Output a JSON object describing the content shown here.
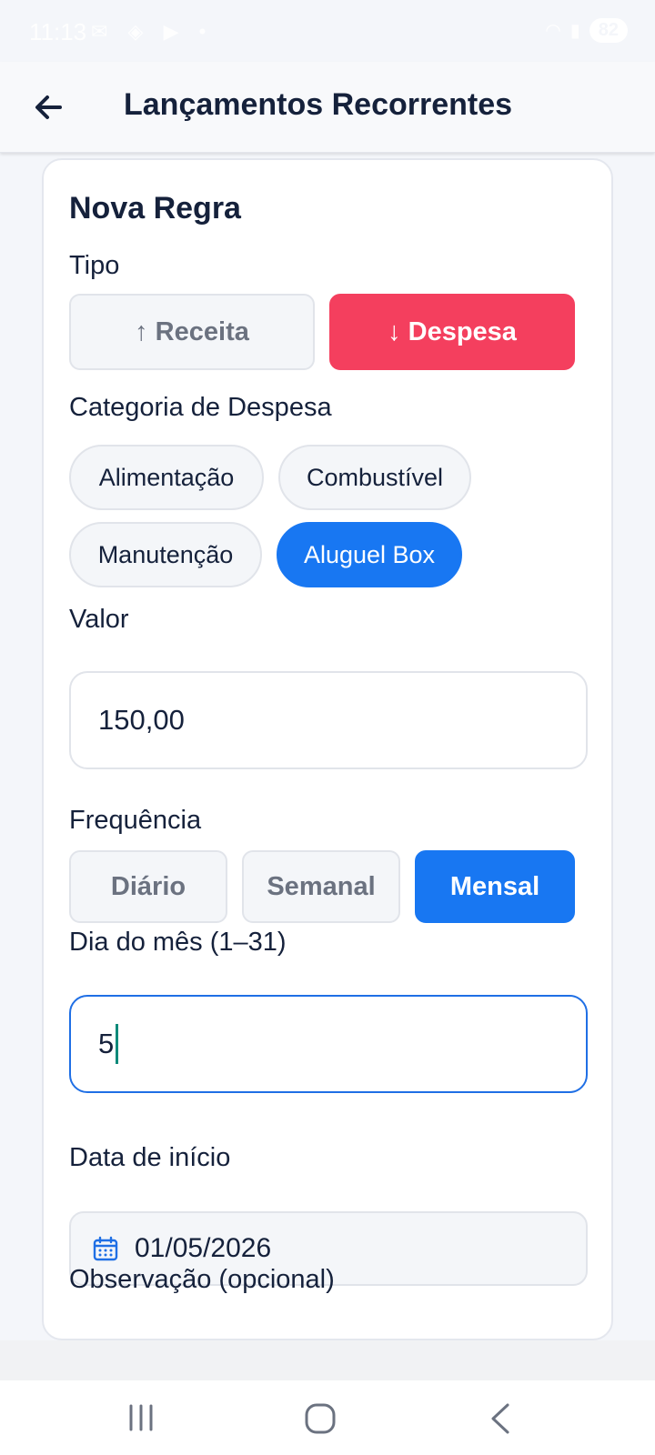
{
  "status_bar": {
    "time": "11:13",
    "icons": [
      "gmail-icon",
      "gamepad-icon",
      "youtube-icon",
      "dot-icon"
    ],
    "battery": "82"
  },
  "app_bar": {
    "title": "Lançamentos Recorrentes"
  },
  "form": {
    "heading": "Nova Regra",
    "tipo": {
      "label": "Tipo",
      "options": [
        {
          "label": "↑ Receita",
          "selected": false
        },
        {
          "label": "↓ Despesa",
          "selected": true
        }
      ]
    },
    "categoria": {
      "label": "Categoria de Despesa",
      "options": [
        {
          "label": "Alimentação",
          "selected": false
        },
        {
          "label": "Combustível",
          "selected": false
        },
        {
          "label": "Manutenção",
          "selected": false
        },
        {
          "label": "Aluguel Box",
          "selected": true
        }
      ]
    },
    "valor": {
      "label": "Valor",
      "value": "150,00"
    },
    "frequencia": {
      "label": "Frequência",
      "options": [
        {
          "label": "Diário",
          "selected": false
        },
        {
          "label": "Semanal",
          "selected": false
        },
        {
          "label": "Mensal",
          "selected": true
        }
      ]
    },
    "dia": {
      "label": "Dia do mês (1–31)",
      "value": "5"
    },
    "data_inicio": {
      "label": "Data de início",
      "value": "01/05/2026"
    },
    "observacao": {
      "label": "Observação (opcional)"
    }
  },
  "colors": {
    "expense_active": "#f43f5e",
    "primary_active": "#1877f2",
    "focus_border": "#1f6fe5",
    "text": "#15213b"
  }
}
